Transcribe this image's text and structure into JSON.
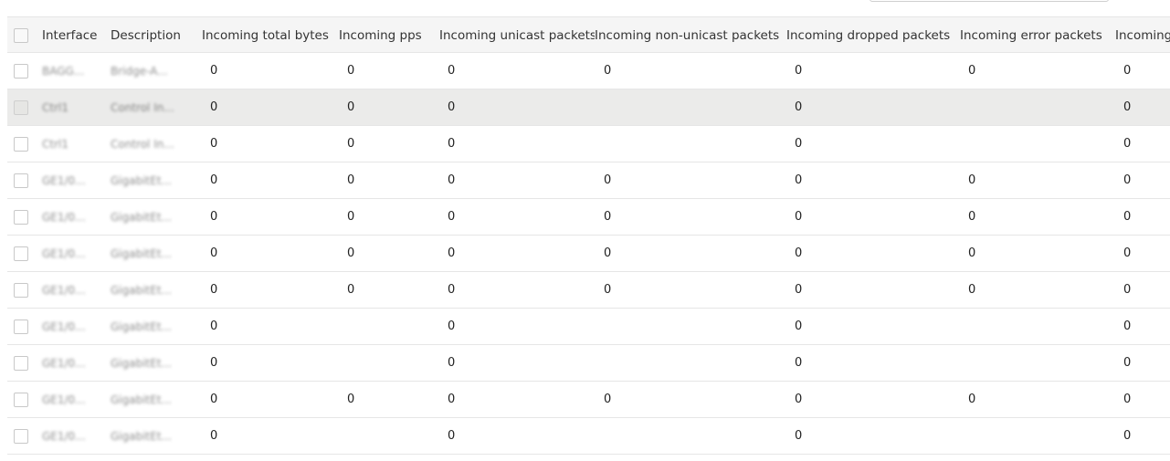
{
  "table": {
    "columns": {
      "interface": "Interface",
      "description": "Description",
      "incoming_total_bytes": "Incoming total bytes",
      "incoming_pps": "Incoming pps",
      "incoming_unicast_packets": "Incoming unicast packets",
      "incoming_non_unicast_packets": "Incoming non-unicast packets",
      "incoming_dropped_packets": "Incoming dropped packets",
      "incoming_error_packets": "Incoming error packets",
      "incoming_more": "Incoming"
    },
    "rows": [
      {
        "interface": "BAGG...",
        "description": "Bridge-A...",
        "tb": "0",
        "pps": "0",
        "uni": "0",
        "nonu": "0",
        "drop": "0",
        "err": "0",
        "inc": "0"
      },
      {
        "interface": "Ctrl1",
        "description": "Control In...",
        "tb": "0",
        "pps": "0",
        "uni": "0",
        "nonu": "",
        "drop": "0",
        "err": "",
        "inc": "0"
      },
      {
        "interface": "Ctrl1",
        "description": "Control In...",
        "tb": "0",
        "pps": "0",
        "uni": "0",
        "nonu": "",
        "drop": "0",
        "err": "",
        "inc": "0"
      },
      {
        "interface": "GE1/0...",
        "description": "GigabitEt...",
        "tb": "0",
        "pps": "0",
        "uni": "0",
        "nonu": "0",
        "drop": "0",
        "err": "0",
        "inc": "0"
      },
      {
        "interface": "GE1/0...",
        "description": "GigabitEt...",
        "tb": "0",
        "pps": "0",
        "uni": "0",
        "nonu": "0",
        "drop": "0",
        "err": "0",
        "inc": "0"
      },
      {
        "interface": "GE1/0...",
        "description": "GigabitEt...",
        "tb": "0",
        "pps": "0",
        "uni": "0",
        "nonu": "0",
        "drop": "0",
        "err": "0",
        "inc": "0"
      },
      {
        "interface": "GE1/0...",
        "description": "GigabitEt...",
        "tb": "0",
        "pps": "0",
        "uni": "0",
        "nonu": "0",
        "drop": "0",
        "err": "0",
        "inc": "0"
      },
      {
        "interface": "GE1/0...",
        "description": "GigabitEt...",
        "tb": "0",
        "pps": "",
        "uni": "0",
        "nonu": "",
        "drop": "0",
        "err": "",
        "inc": "0"
      },
      {
        "interface": "GE1/0...",
        "description": "GigabitEt...",
        "tb": "0",
        "pps": "",
        "uni": "0",
        "nonu": "",
        "drop": "0",
        "err": "",
        "inc": "0"
      },
      {
        "interface": "GE1/0...",
        "description": "GigabitEt...",
        "tb": "0",
        "pps": "0",
        "uni": "0",
        "nonu": "0",
        "drop": "0",
        "err": "0",
        "inc": "0"
      },
      {
        "interface": "GE1/0...",
        "description": "GigabitEt...",
        "tb": "0",
        "pps": "",
        "uni": "0",
        "nonu": "",
        "drop": "0",
        "err": "",
        "inc": "0"
      }
    ]
  }
}
